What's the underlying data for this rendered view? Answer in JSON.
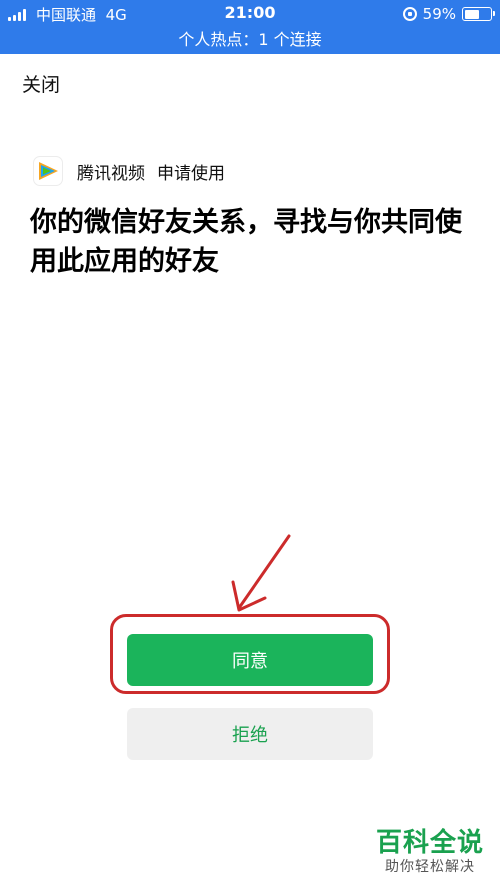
{
  "status_bar": {
    "carrier": "中国联通",
    "network": "4G",
    "time": "21:00",
    "battery": "59%",
    "battery_level": 0.59
  },
  "hotspot_banner": "个人热点：1 个连接",
  "close_label": "关闭",
  "app": {
    "name": "腾讯视频",
    "request": "申请使用",
    "icon": "tencent-video-play-icon"
  },
  "permission_text": "你的微信好友关系，寻找与你共同使用此应用的好友",
  "buttons": {
    "agree": "同意",
    "reject": "拒绝"
  },
  "watermark": {
    "title": "百科全说",
    "subtitle": "助你轻松解决"
  },
  "colors": {
    "status_bar": "#2f7bea",
    "agree_button": "#1bb45b",
    "reject_button_bg": "#efefef",
    "annotation": "#cc2b2b"
  }
}
